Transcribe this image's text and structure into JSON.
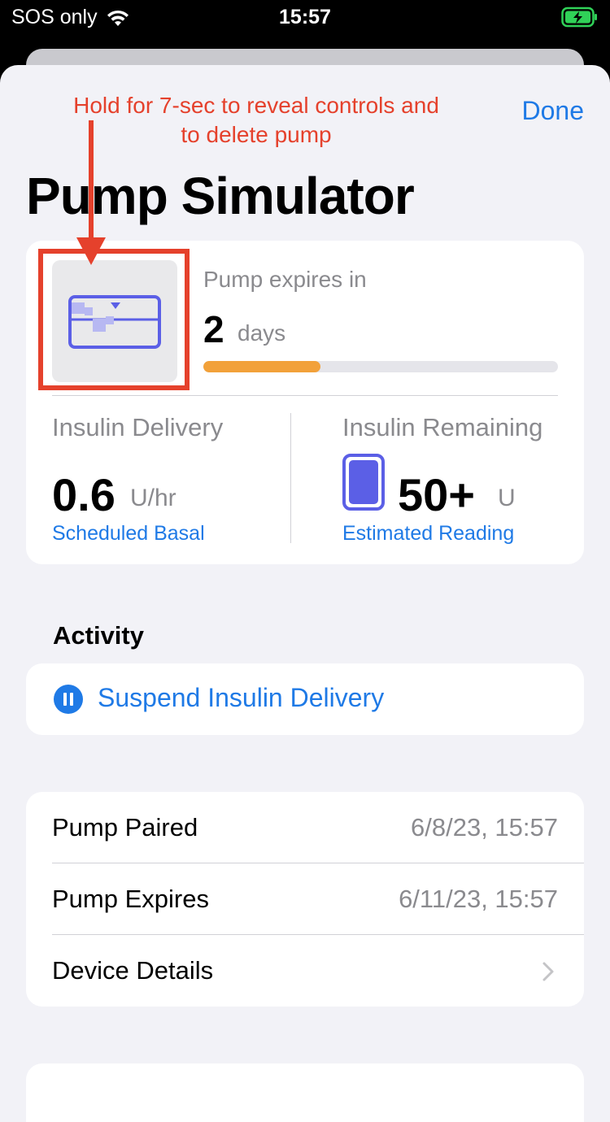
{
  "status_bar": {
    "carrier": "SOS only",
    "time": "15:57",
    "icons": [
      "wifi-icon",
      "battery-charging-icon"
    ],
    "battery_color": "#30d158"
  },
  "header": {
    "done_label": "Done",
    "title": "Pump Simulator",
    "annotation": "Hold for 7-sec to reveal controls and to delete pump"
  },
  "status_card": {
    "icon": "pump-icon",
    "expires_label": "Pump expires in",
    "expires_value": "2",
    "expires_unit": "days",
    "expires_progress": 0.33,
    "delivery": {
      "label": "Insulin Delivery",
      "value": "0.6",
      "unit": "U/hr",
      "sub": "Scheduled Basal"
    },
    "remaining": {
      "label": "Insulin Remaining",
      "value": "50+",
      "unit": "U",
      "sub": "Estimated Reading",
      "icon": "reservoir-icon"
    }
  },
  "activity": {
    "header": "Activity",
    "suspend_label": "Suspend Insulin Delivery",
    "icon": "pause-icon"
  },
  "info": {
    "rows": [
      {
        "label": "Pump Paired",
        "value": "6/8/23, 15:57"
      },
      {
        "label": "Pump Expires",
        "value": "6/11/23, 15:57"
      },
      {
        "label": "Device Details",
        "value": ""
      }
    ]
  },
  "colors": {
    "accent": "#1f7ae6",
    "annotation": "#e5412c",
    "progress": "#f2a13a",
    "reservoir": "#5b5fe6",
    "background": "#f2f2f7"
  }
}
